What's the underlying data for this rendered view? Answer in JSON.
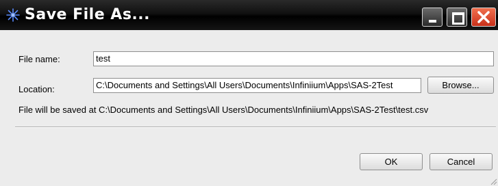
{
  "window": {
    "title": "Save File As...",
    "controls": {
      "minimize": "minimize",
      "maximize": "maximize",
      "close": "close"
    }
  },
  "form": {
    "file_name_label": "File name:",
    "file_name_value": "test",
    "location_label": "Location:",
    "location_value": "C:\\Documents and Settings\\All Users\\Documents\\Infiniium\\Apps\\SAS-2Test",
    "browse_label": "Browse...",
    "info_text": "File will be saved at C:\\Documents and Settings\\All Users\\Documents\\Infiniium\\Apps\\SAS-2Test\\test.csv"
  },
  "buttons": {
    "ok_label": "OK",
    "cancel_label": "Cancel"
  },
  "icons": {
    "app": "agilent-spark-icon",
    "minimize": "minimize-icon",
    "maximize": "maximize-icon",
    "close": "close-icon"
  },
  "colors": {
    "titlebar": "#000000",
    "close_button": "#d9432a",
    "app_icon": "#3f7fff"
  }
}
